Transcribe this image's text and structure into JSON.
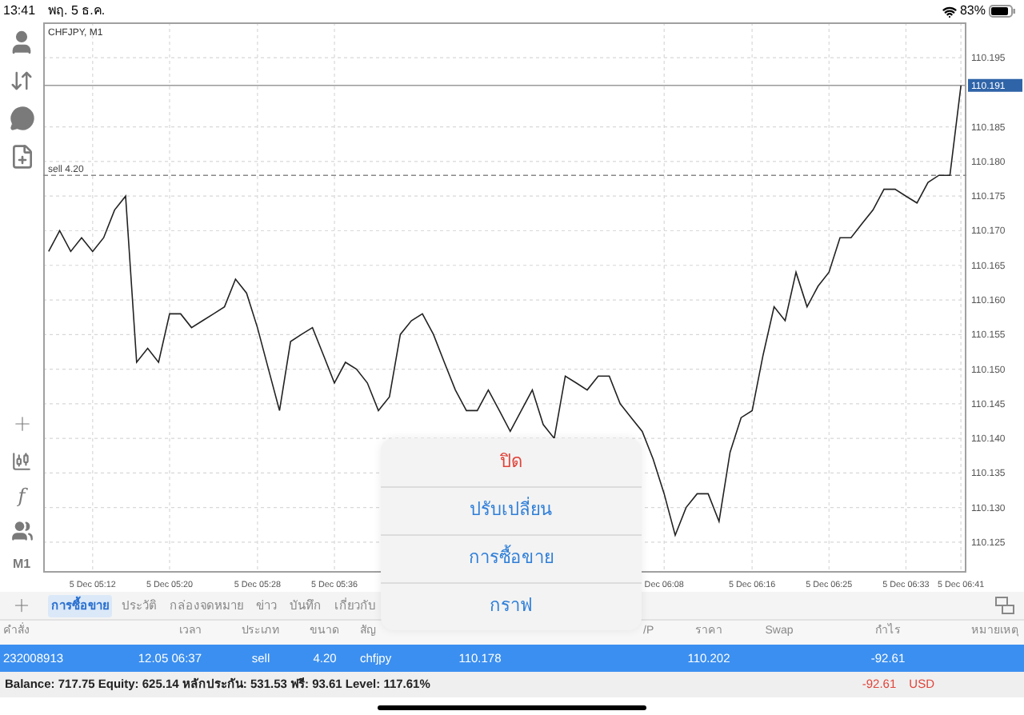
{
  "status_bar": {
    "time": "13:41",
    "date": "พฤ. 5 ธ.ค.",
    "battery_text": "83%"
  },
  "toolbar": {
    "function_glyph": "f",
    "timeframe": "M1"
  },
  "chart": {
    "chart_data": {
      "type": "line",
      "title": "CHFJPY, M1",
      "grid": true,
      "ylim": [
        110.1206,
        110.2001
      ],
      "categories": [
        null,
        null,
        null,
        null,
        "5 Dec 05:12",
        null,
        null,
        null,
        null,
        null,
        null,
        "5 Dec 05:20",
        null,
        null,
        null,
        null,
        null,
        null,
        null,
        "5 Dec 05:28",
        null,
        null,
        null,
        null,
        null,
        null,
        "5 Dec 05:36",
        null,
        null,
        null,
        null,
        null,
        null,
        null,
        null,
        null,
        null,
        null,
        null,
        null,
        null,
        null,
        null,
        null,
        null,
        null,
        null,
        null,
        null,
        null,
        null,
        null,
        null,
        null,
        null,
        null,
        "Dec 06:08",
        null,
        null,
        null,
        null,
        null,
        null,
        null,
        "5 Dec 06:16",
        null,
        null,
        null,
        null,
        null,
        null,
        "5 Dec 06:25",
        null,
        null,
        null,
        null,
        null,
        null,
        "5 Dec 06:33",
        null,
        null,
        null,
        null,
        "5 Dec 06:41"
      ],
      "series": [
        {
          "color": "#222222",
          "values": [
            110.167,
            110.17,
            110.167,
            110.169,
            110.167,
            110.169,
            110.173,
            110.175,
            110.151,
            110.153,
            110.151,
            110.158,
            110.158,
            110.156,
            110.157,
            110.158,
            110.159,
            110.163,
            110.161,
            110.156,
            110.15,
            110.144,
            110.154,
            110.155,
            110.156,
            110.152,
            110.148,
            110.151,
            110.15,
            110.148,
            110.144,
            110.146,
            110.155,
            110.157,
            110.158,
            110.155,
            110.151,
            110.147,
            110.144,
            110.144,
            110.147,
            110.144,
            110.141,
            110.144,
            110.147,
            110.142,
            110.14,
            110.149,
            110.148,
            110.147,
            110.149,
            110.149,
            110.145,
            110.143,
            110.141,
            110.137,
            110.132,
            110.126,
            110.13,
            110.132,
            110.132,
            110.128,
            110.138,
            110.143,
            110.144,
            110.152,
            110.159,
            110.157,
            110.164,
            110.159,
            110.162,
            110.164,
            110.169,
            110.169,
            110.171,
            110.173,
            110.176,
            110.176,
            110.175,
            110.174,
            110.177,
            110.178,
            110.178,
            110.191
          ]
        }
      ],
      "yticks": [
        {
          "value": 110.125,
          "label": "110.125"
        },
        {
          "value": 110.13,
          "label": "110.130"
        },
        {
          "value": 110.135,
          "label": "110.135"
        },
        {
          "value": 110.14,
          "label": "110.140"
        },
        {
          "value": 110.145,
          "label": "110.145"
        },
        {
          "value": 110.15,
          "label": "110.150"
        },
        {
          "value": 110.155,
          "label": "110.155"
        },
        {
          "value": 110.16,
          "label": "110.160"
        },
        {
          "value": 110.165,
          "label": "110.165"
        },
        {
          "value": 110.17,
          "label": "110.170"
        },
        {
          "value": 110.175,
          "label": "110.175"
        },
        {
          "value": 110.18,
          "label": "110.180"
        },
        {
          "value": 110.185,
          "label": "110.185"
        },
        {
          "value": 110.195,
          "label": "110.195"
        }
      ],
      "ref_lines": [
        {
          "axis": "y",
          "value": 110.178,
          "label": "sell 4.20",
          "color": "#888888"
        },
        {
          "axis": "y",
          "value": 110.191,
          "label": "110.191",
          "color": "#9a9a9a"
        }
      ]
    }
  },
  "tabs": [
    {
      "label": "การซื้อขาย",
      "selected": true
    },
    {
      "label": "ประวัติ",
      "selected": false
    },
    {
      "label": "กล่องจดหมาย",
      "selected": false
    },
    {
      "label": "ข่าว",
      "selected": false
    },
    {
      "label": "บันทึก",
      "selected": false
    },
    {
      "label": "เกี่ยวกับ",
      "selected": false
    }
  ],
  "table": {
    "columns": [
      "คำสั่ง",
      "เวลา",
      "ประเภท",
      "ขนาด",
      "สัญ",
      null,
      null,
      "/P",
      "ราคา",
      "Swap",
      "กำไร",
      "หมายเหตุ"
    ],
    "rows": [
      {
        "selected": true,
        "cells": [
          "232008913",
          "12.05 06:37",
          "sell",
          "4.20",
          "chfjpy",
          "110.178",
          null,
          null,
          "110.202",
          null,
          "-92.61",
          null
        ]
      }
    ]
  },
  "summary": {
    "text": "Balance: 717.75 Equity: 625.14 หลักประกัน: 531.53 ฟรี: 93.61 Level: 117.61%",
    "profit": "-92.61",
    "currency": "USD"
  },
  "popup_menu": {
    "items": [
      {
        "label": "ปิด",
        "kind": "destructive"
      },
      {
        "label": "ปรับเปลี่ยน",
        "kind": "normal"
      },
      {
        "label": "การซื้อขาย",
        "kind": "normal"
      },
      {
        "label": "กราฟ",
        "kind": "normal"
      }
    ]
  }
}
